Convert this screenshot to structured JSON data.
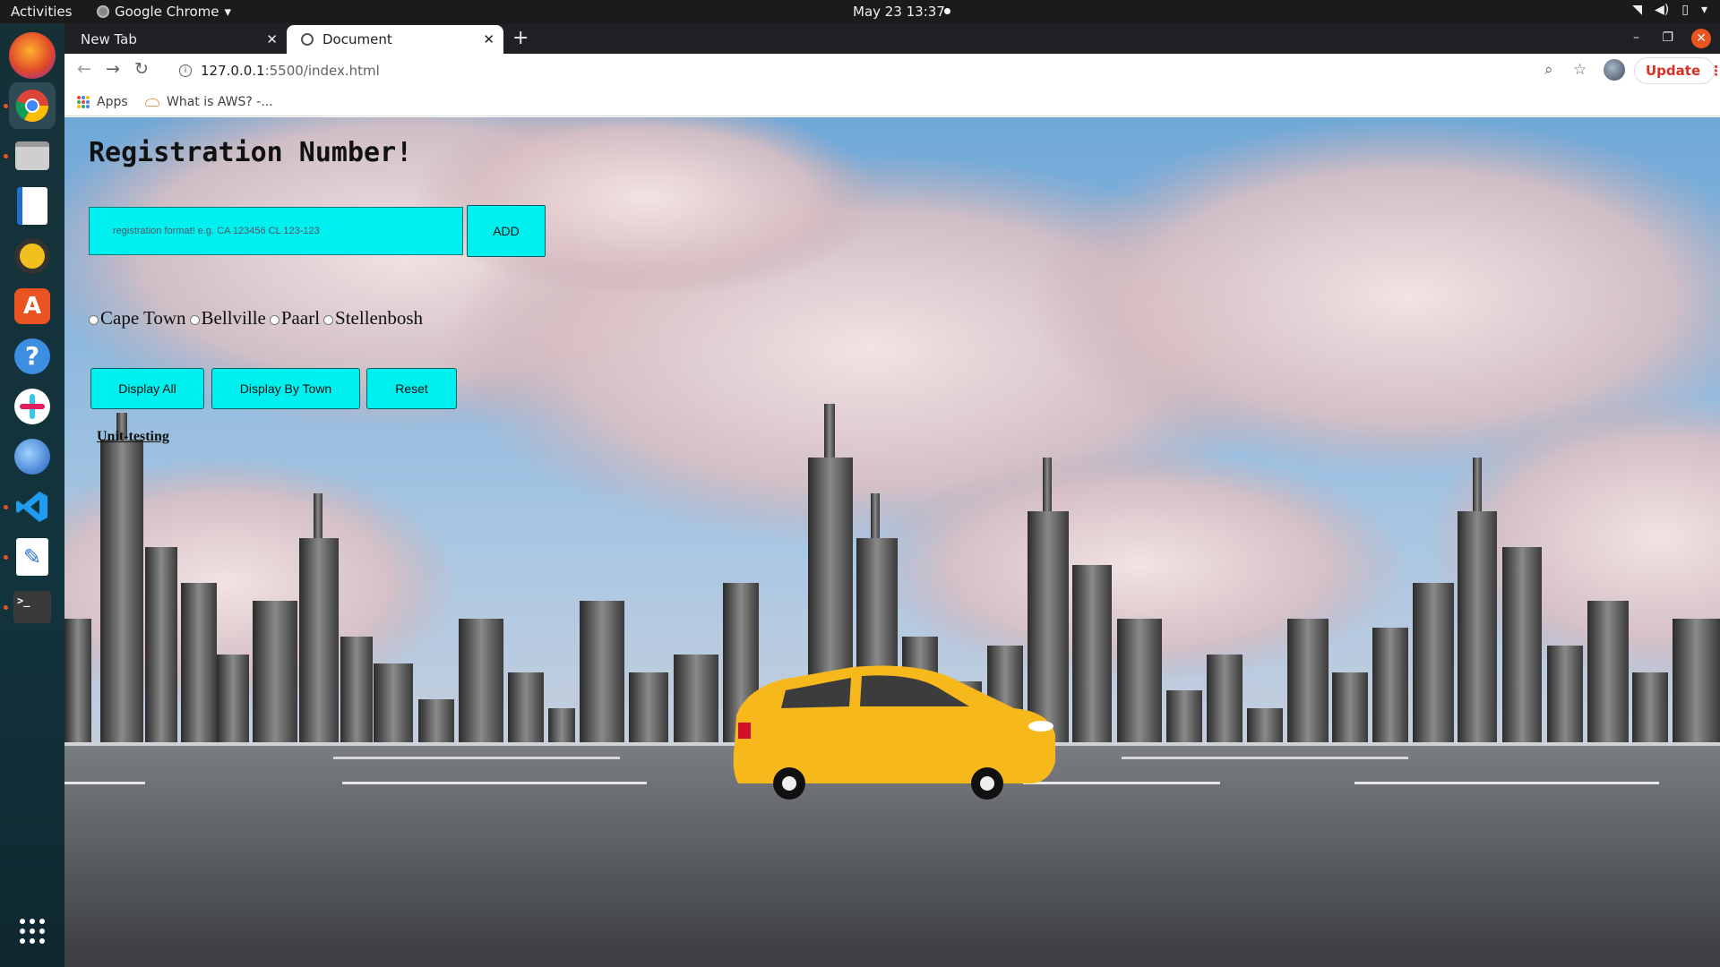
{
  "topbar": {
    "activities": "Activities",
    "app_name": "Google Chrome",
    "datetime": "May 23  13:37"
  },
  "dock": {
    "items": [
      "firefox-icon",
      "chrome-icon",
      "files-icon",
      "writer-icon",
      "rhythmbox-icon",
      "software-icon",
      "help-icon",
      "slack-icon",
      "thunderbird-icon",
      "vscode-icon",
      "text-editor-icon",
      "terminal-icon",
      "app-grid-icon"
    ]
  },
  "browser": {
    "tabs": [
      {
        "label": "New Tab"
      },
      {
        "label": "Document"
      }
    ],
    "url_host": "127.0.0.1",
    "url_path": ":5500/index.html",
    "update_label": "Update",
    "bookmarks": [
      {
        "label": "Apps"
      },
      {
        "label": "What is AWS? -..."
      }
    ]
  },
  "page": {
    "title": "Registration Number!",
    "input_placeholder": "registration format! e.g. CA 123456 CL 123-123",
    "add_label": "ADD",
    "towns": [
      "Cape Town",
      "Bellville",
      "Paarl",
      "Stellenbosh"
    ],
    "buttons": {
      "display_all": "Display All",
      "display_by_town": "Display By Town",
      "reset": "Reset"
    },
    "link": "Unit-testing"
  },
  "colors": {
    "accent_cyan": "#00f0f0",
    "taxi_yellow": "#f7b81c",
    "ubuntu_orange": "#e95420"
  }
}
